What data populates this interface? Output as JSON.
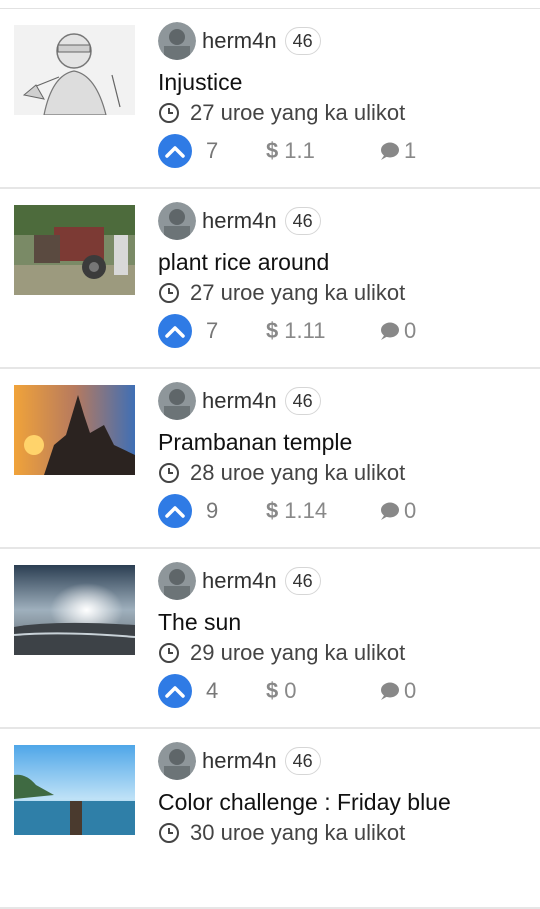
{
  "posts": [
    {
      "author": "herm4n",
      "reputation": "46",
      "title": "Injustice",
      "time": "27 uroe yang ka ulikot",
      "votes": "7",
      "payout": "1.1",
      "comments": "1",
      "thumb": "justice"
    },
    {
      "author": "herm4n",
      "reputation": "46",
      "title": "plant rice around",
      "time": "27 uroe yang ka ulikot",
      "votes": "7",
      "payout": "1.11",
      "comments": "0",
      "thumb": "tractor"
    },
    {
      "author": "herm4n",
      "reputation": "46",
      "title": "Prambanan temple",
      "time": "28 uroe yang ka ulikot",
      "votes": "9",
      "payout": "1.14",
      "comments": "0",
      "thumb": "temple"
    },
    {
      "author": "herm4n",
      "reputation": "46",
      "title": "The sun",
      "time": "29 uroe yang ka ulikot",
      "votes": "4",
      "payout": "0",
      "comments": "0",
      "thumb": "sun"
    },
    {
      "author": "herm4n",
      "reputation": "46",
      "title": "Color challenge : Friday blue",
      "time": "30 uroe yang ka ulikot",
      "votes": "",
      "payout": "",
      "comments": "",
      "thumb": "pier"
    }
  ],
  "currency_symbol": "$",
  "colors": {
    "accent": "#2f7be5",
    "muted": "#888888"
  }
}
